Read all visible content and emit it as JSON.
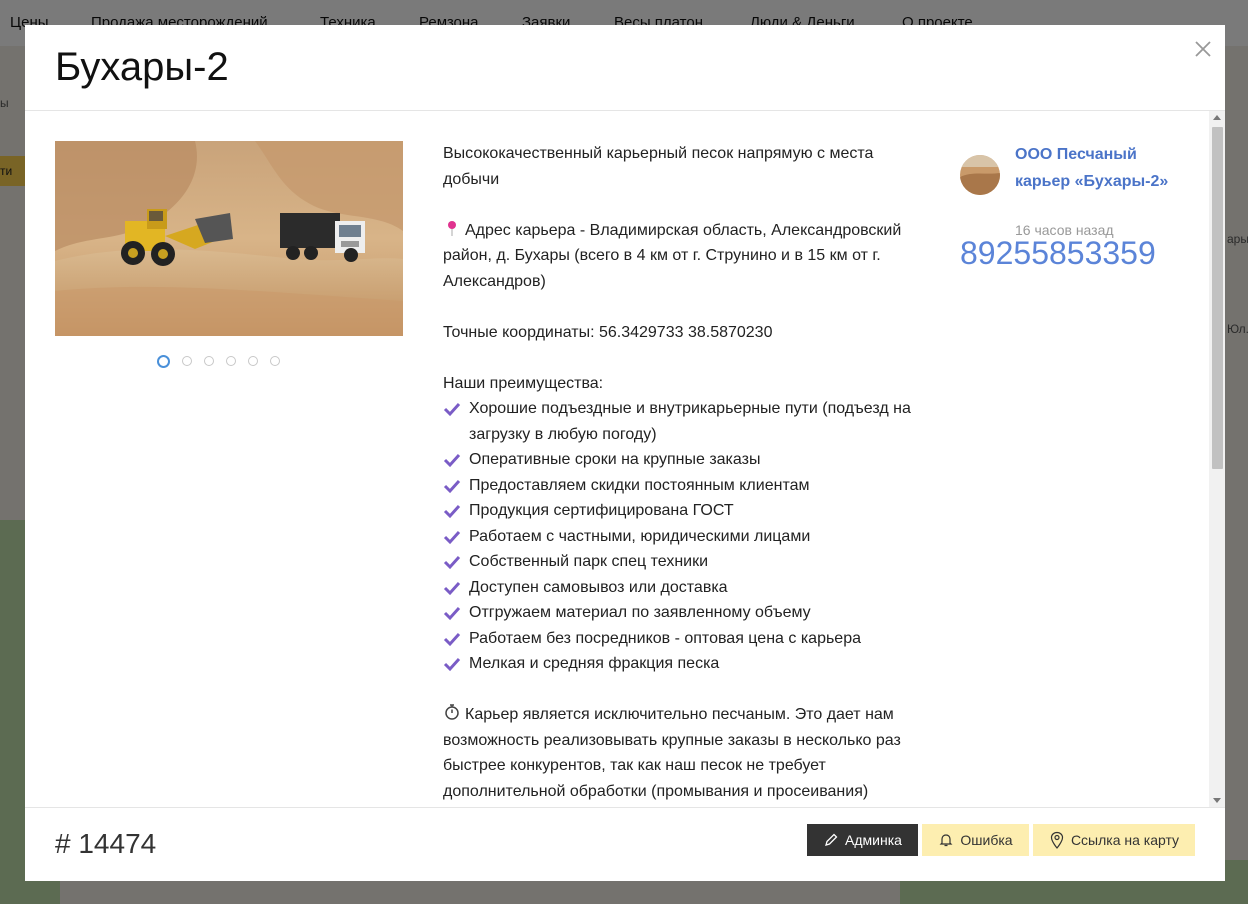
{
  "background": {
    "nav_items": [
      "Цены",
      "Продажа месторождений",
      "Техника",
      "Ремзона",
      "Заявки",
      "Весы платон",
      "Люди & Деньги",
      "О проекте"
    ],
    "side_left_1": "ы",
    "side_left_2": "ти",
    "side_right_1": "ары",
    "side_right_2": "Юл."
  },
  "modal": {
    "title": "Бухары-2",
    "close_icon": "close-icon",
    "gallery": {
      "slide_count": 6,
      "active_index": 0
    },
    "description": {
      "intro": "Высококачественный карьерный песок напрямую с места добычи",
      "address": "Адрес карьера - Владимирская область, Александровский район, д. Бухары (всего в 4 км от г. Струнино и в 15 км от г. Александров)",
      "coordinates": "Точные координаты: 56.3429733  38.5870230",
      "advantages_heading": "Наши преимущества:",
      "advantages": [
        "Хорошие подъездные и внутрикарьерные пути (подъезд на загрузку в любую погоду)",
        "Оперативные сроки на крупные заказы",
        "Предоставляем скидки постоянным клиентам",
        "Продукция сертифицирована ГОСТ",
        "Работаем с частными, юридическими лицами",
        "Собственный парк спец техники",
        "Доступен самовывоз или доставка",
        "Отгружаем материал по заявленному объему",
        "Работаем без посредников - оптовая цена с карьера",
        "Мелкая и средняя фракция песка"
      ],
      "closing": "Карьер является исключительно песчаным. Это дает нам возможность реализовывать крупные заказы в несколько раз быстрее конкурентов, так как наш песок не требует дополнительной обработки (промывания и просеивания)"
    },
    "seller": {
      "name": "ООО Песчаный карьер «Бухары-2»",
      "posted": "16 часов назад",
      "phone": "89255853359"
    },
    "footer": {
      "post_id": "# 14474",
      "admin_label": "Админка",
      "error_label": "Ошибка",
      "map_label": "Ссылка на карту"
    }
  },
  "colors": {
    "accent_link": "#4b74c8",
    "phone": "#5b84d8",
    "check": "#7a5cc6",
    "yellow_button": "#fdeeb0",
    "dark_button": "#333333"
  }
}
